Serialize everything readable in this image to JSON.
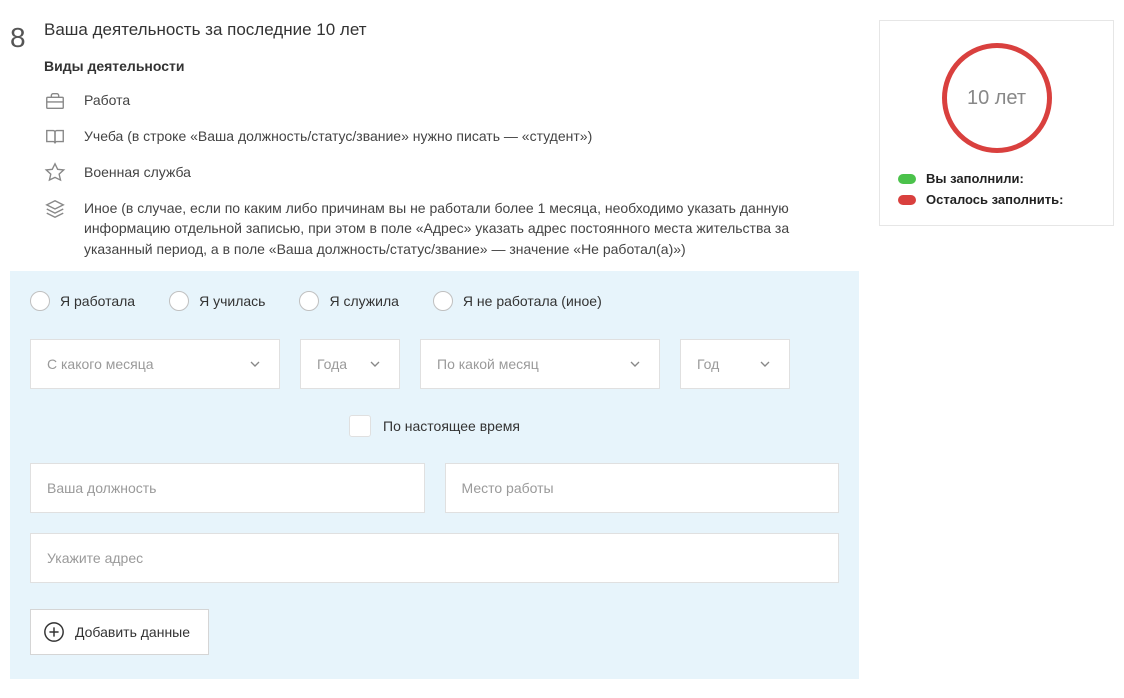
{
  "step_number": "8",
  "section_title": "Ваша деятельность за последние 10 лет",
  "sub_title": "Виды деятельности",
  "activities": {
    "work": "Работа",
    "study": "Учеба (в строке «Ваша должность/статус/звание» нужно писать — «студент»)",
    "military": "Военная служба",
    "other": "Иное (в случае, если по каким либо причинам вы не работали более 1 месяца, необходимо указать данную информацию отдельной записью, при этом в поле «Адрес» указать адрес постоянного места жительства за указанный период, а в поле «Ваша должность/статус/звание» — значение «Не работал(а)»)"
  },
  "radios": {
    "worked": "Я работала",
    "studied": "Я училась",
    "served": "Я служила",
    "not_worked": "Я не работала (иное)"
  },
  "selects": {
    "from_month": "С какого месяца",
    "from_year": "Года",
    "to_month": "По какой месяц",
    "to_year": "Год"
  },
  "present_checkbox_label": "По настоящее время",
  "inputs": {
    "position": "Ваша должность",
    "workplace": "Место работы",
    "address": "Укажите адрес"
  },
  "add_button": "Добавить данные",
  "sidebar": {
    "ring_label": "10 лет",
    "filled_label": "Вы заполнили:",
    "remaining_label": "Осталось заполнить:"
  }
}
